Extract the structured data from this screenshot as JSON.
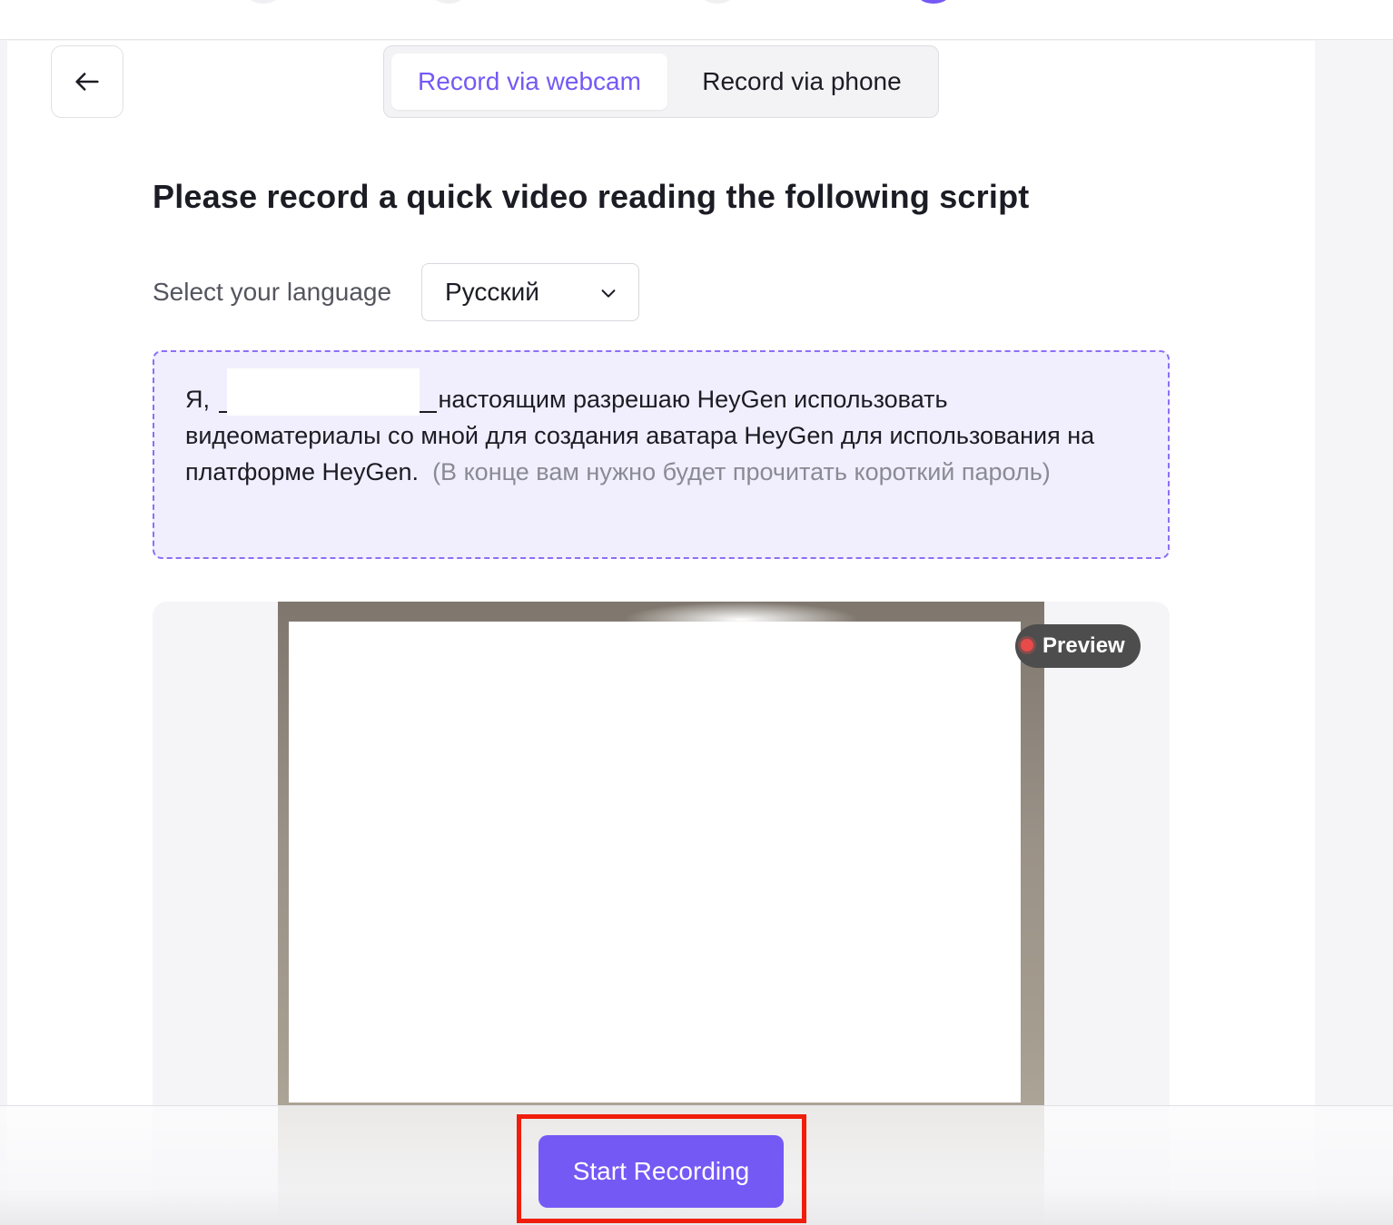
{
  "tabs": {
    "webcam": "Record via webcam",
    "phone": "Record via phone"
  },
  "heading": "Please record a quick video reading the following script",
  "language": {
    "label": "Select your language",
    "selected": "Русский"
  },
  "script": {
    "prefix": "Я,",
    "body": "настоящим разрешаю HeyGen использовать видеоматериалы со мной для создания аватара HeyGen для использования на платформе HeyGen.",
    "hint": "(В конце вам нужно будет прочитать короткий пароль)"
  },
  "preview": {
    "label": "Preview"
  },
  "actions": {
    "start_recording": "Start Recording"
  },
  "colors": {
    "accent": "#7559f5",
    "highlight": "#f01d0a"
  },
  "icons": {
    "back": "arrow-left-icon",
    "dropdown": "chevron-down-icon",
    "record_indicator": "record-dot-icon"
  }
}
